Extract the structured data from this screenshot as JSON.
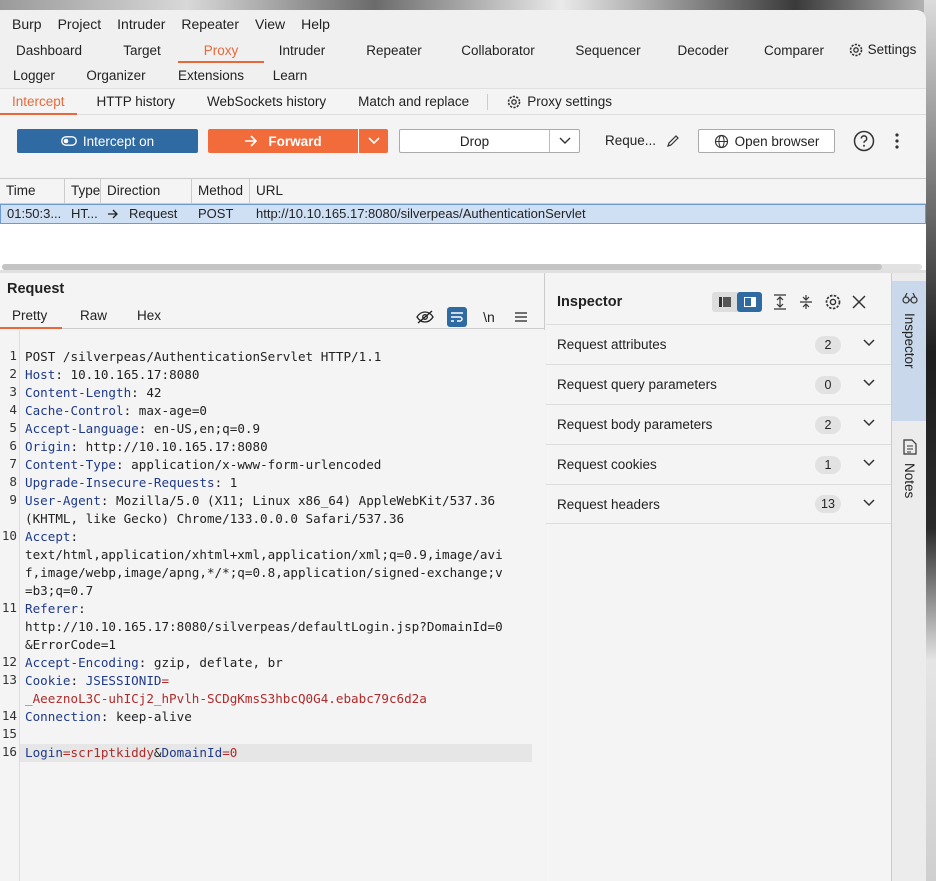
{
  "menu": [
    "Burp",
    "Project",
    "Intruder",
    "Repeater",
    "View",
    "Help"
  ],
  "main_tabs_row1": [
    "Dashboard",
    "Target",
    "Proxy",
    "Intruder",
    "Repeater",
    "Collaborator",
    "Sequencer",
    "Decoder",
    "Comparer",
    "Settings"
  ],
  "main_tabs_row2": [
    "Logger",
    "Organizer",
    "Extensions",
    "Learn"
  ],
  "active_main_tab": "Proxy",
  "proxy_tabs": [
    "Intercept",
    "HTTP history",
    "WebSockets history",
    "Match and replace",
    "Proxy settings"
  ],
  "active_proxy_tab": "Intercept",
  "toolbar": {
    "intercept": "Intercept on",
    "forward": "Forward",
    "drop": "Drop",
    "request_label": "Reque...",
    "open_browser": "Open browser"
  },
  "table": {
    "columns": [
      "Time",
      "Type",
      "Direction",
      "Method",
      "URL"
    ],
    "rows": [
      {
        "time": "01:50:3...",
        "type": "HT...",
        "direction": "Request",
        "method": "POST",
        "url": "http://10.10.165.17:8080/silverpeas/AuthenticationServlet"
      }
    ]
  },
  "request": {
    "title": "Request",
    "tabs": [
      "Pretty",
      "Raw",
      "Hex"
    ],
    "active_tab": "Pretty",
    "newline_toggle": "\\n",
    "lines": [
      {
        "n": "1",
        "text": "POST /silverpeas/AuthenticationServlet HTTP/1.1"
      },
      {
        "n": "2",
        "key": "Host",
        "val": " 10.10.165.17:8080"
      },
      {
        "n": "3",
        "key": "Content-Length",
        "val": " 42"
      },
      {
        "n": "4",
        "key": "Cache-Control",
        "val": " max-age=0"
      },
      {
        "n": "5",
        "key": "Accept-Language",
        "val": " en-US,en;q=0.9"
      },
      {
        "n": "6",
        "key": "Origin",
        "val": " http://10.10.165.17:8080"
      },
      {
        "n": "7",
        "key": "Content-Type",
        "val": " application/x-www-form-urlencoded"
      },
      {
        "n": "8",
        "key": "Upgrade-Insecure-Requests",
        "val": " 1"
      },
      {
        "n": "9",
        "key": "User-Agent",
        "val": " Mozilla/5.0 (X11; Linux x86_64) AppleWebKit/537.36",
        "cont": [
          "(KHTML, like Gecko) Chrome/133.0.0.0 Safari/537.36"
        ]
      },
      {
        "n": "10",
        "key": "Accept",
        "val": "",
        "cont": [
          "text/html,application/xhtml+xml,application/xml;q=0.9,image/avi",
          "f,image/webp,image/apng,*/*;q=0.8,application/signed-exchange;v",
          "=b3;q=0.7"
        ]
      },
      {
        "n": "11",
        "key": "Referer",
        "val": "",
        "cont": [
          "http://10.10.165.17:8080/silverpeas/defaultLogin.jsp?DomainId=0",
          "&ErrorCode=1"
        ]
      },
      {
        "n": "12",
        "key": "Accept-Encoding",
        "val": " gzip, deflate, br"
      },
      {
        "n": "13",
        "key": "Cookie",
        "val": " ",
        "cookie_name": "JSESSIONID",
        "cookie_eq": "=",
        "cookie_val": "_AeeznoL3C-uhICj2_hPvlh-SCDgKmsS3hbcQ0G4.ebabc79c6d2a"
      },
      {
        "n": "14",
        "key": "Connection",
        "val": " keep-alive"
      },
      {
        "n": "15",
        "text": ""
      },
      {
        "n": "16",
        "body": [
          {
            "k": "Login"
          },
          {
            "s": "="
          },
          {
            "v": "scr1ptkiddy"
          },
          {
            "s": "&"
          },
          {
            "k": "DomainId"
          },
          {
            "s": "="
          },
          {
            "v": "0"
          }
        ]
      }
    ]
  },
  "inspector": {
    "title": "Inspector",
    "sections": [
      {
        "label": "Request attributes",
        "count": "2"
      },
      {
        "label": "Request query parameters",
        "count": "0"
      },
      {
        "label": "Request body parameters",
        "count": "2"
      },
      {
        "label": "Request cookies",
        "count": "1"
      },
      {
        "label": "Request headers",
        "count": "13"
      }
    ]
  },
  "side_tabs": [
    "Inspector",
    "Notes"
  ],
  "colors": {
    "accent": "#e8683a",
    "intercept_blue": "#2f6aa3",
    "forward_orange": "#f26b3a",
    "selected_row": "#cfe0f5",
    "header_key": "#1f3a8a",
    "cookie_red": "#b02a2a"
  }
}
